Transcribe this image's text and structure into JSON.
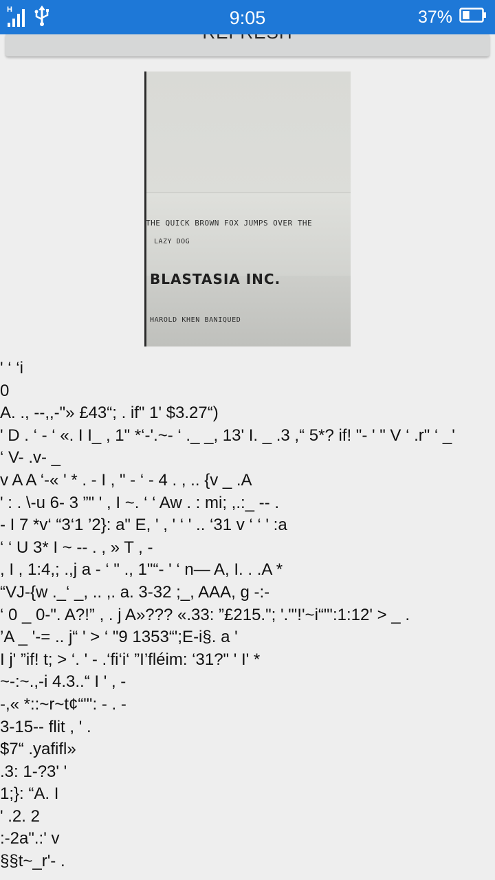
{
  "status_bar": {
    "network_type": "H",
    "time": "9:05",
    "battery_percent": "37%",
    "battery_level": 0.37
  },
  "button": {
    "label": "REFRESH"
  },
  "photo": {
    "line1": "THE QUICK BROWN FOX JUMPS OVER THE",
    "line2": "LAZY DOG",
    "company": "BLASTASIA INC.",
    "name": "HAROLD KHEN BANIQUED"
  },
  "ocr_lines": [
    "' ‘ ‘i",
    "0",
    "A. ., --,,-\"» £43“; . if\" 1' $3.27“)",
    "' D . ‘ - ‘ «. I I_ , 1\" *‘-'.~- ‘ ._ _, 13' I. _ .3 ,“ 5*? if! \"- ' \" V ‘ .r\" ‘ _'",
    "‘ V- .v- _",
    "v A A ‘-« ' * . - I , \" - ‘ - 4 . , .. {v _ .A",
    "' : . \\-u 6- 3 ”\" ' , I ~. ‘ ‘ Aw . : mi; ,.:_ -- .",
    "- I 7 *v‘ “3‘1 ’2}: a\" E, ' , ' ‘ ' .. ‘31 v ‘ ‘ ' :a",
    "‘ ‘ U 3* I ~ -- . , » T , -",
    ", I , 1:4,; .,j a - ‘ \" ., 1\"“- ' ‘ n— A, I. . .A *",
    "“VJ-{w ._‘ _, .. ,. a. 3-32 ;_, AAA, g -:-",
    "‘ 0 _ 0-\". A?!” , . j A»??? «.33: ”£215.\"; '.\"'!'~i“\"':1:12' > _ .",
    "’A _ '-= .. j“ ' > ‘ \"9 1353“';E-i§. a '",
    "I j' ”if! t; > ‘. ' - .‘fi‘i‘ ”I’fléim: ‘31?\" ' I' *",
    "~-:~.,-i 4.3..“ I ' , -",
    "-,« *::~r~t¢“\"': - . -",
    "3-15-- flit , ' .",
    "$7“ .yafifl»",
    ".3: 1-?3' '",
    "1;}: “A. I",
    "' .2. 2",
    ":-2a\".:' v",
    "§§t~_r'- ."
  ]
}
